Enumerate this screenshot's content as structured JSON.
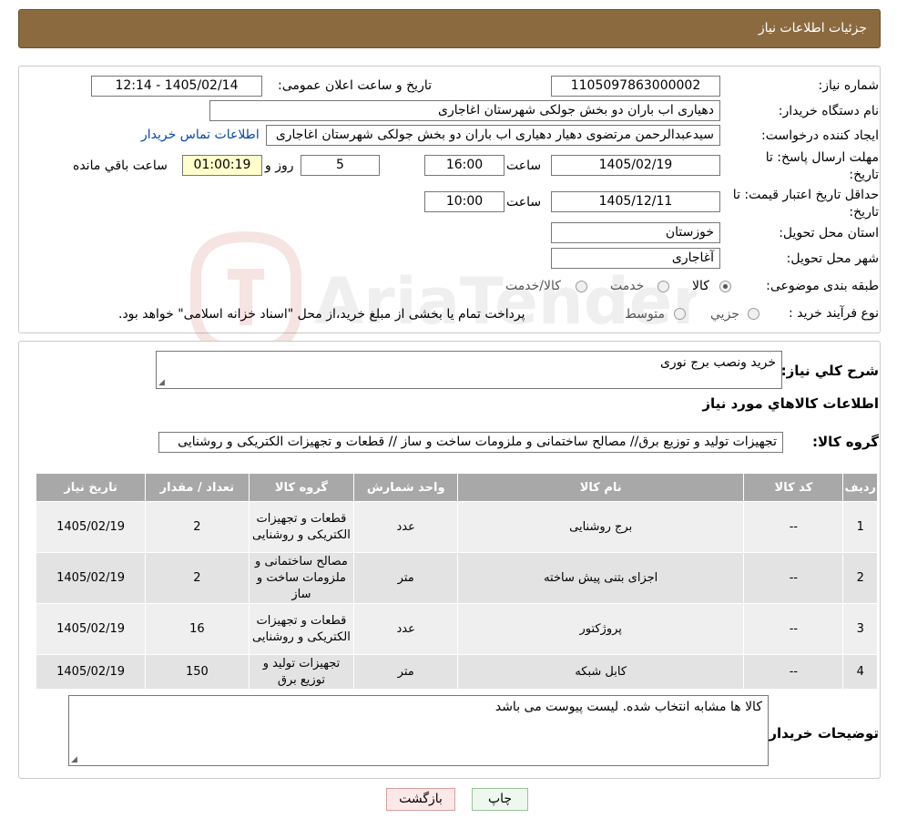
{
  "header": {
    "title": "جزئیات اطلاعات نیاز"
  },
  "form": {
    "need_number_label": "شماره نیاز:",
    "need_number": "1105097863000002",
    "announce_label": "تاریخ و ساعت اعلان عمومی:",
    "announce_value": "1405/02/14 - 12:14",
    "buyer_org_label": "نام دستگاه خریدار:",
    "buyer_org": "دهیاری اب باران دو بخش جولکی شهرستان اغاجاری",
    "requester_label": "ایجاد کننده درخواست:",
    "requester": "سیدعبدالرحمن مرتضوی دهیار دهیاری اب باران دو بخش جولکی شهرستان اغاجاری",
    "contact_link": "اطلاعات تماس خریدار",
    "deadline_label_1": "مهلت ارسال پاسخ: تا",
    "deadline_label_2": "تاریخ:",
    "deadline_date": "1405/02/19",
    "time_label": "ساعت",
    "deadline_time": "16:00",
    "days_value": "5",
    "days_label": "روز و",
    "remaining_time": "01:00:19",
    "remaining_label": "ساعت باقي مانده",
    "validity_label_1": "حداقل تاریخ اعتبار قیمت: تا",
    "validity_label_2": "تاریخ:",
    "validity_date": "1405/12/11",
    "validity_time_label": "ساعت",
    "validity_time": "10:00",
    "province_label": "استان محل تحویل:",
    "province": "خوزستان",
    "city_label": "شهر محل تحویل:",
    "city": "آغاجاری",
    "category_label": "طبقه بندی موضوعی:",
    "category_options": [
      "کالا",
      "خدمت",
      "کالا/خدمت"
    ],
    "category_selected": "کالا",
    "process_label": "نوع فرآیند خرید :",
    "process_options": [
      "جزیي",
      "متوسط"
    ],
    "process_note": "پرداخت تمام یا بخشی از مبلغ خرید،از محل \"اسناد خزانه اسلامی\" خواهد بود."
  },
  "details": {
    "summary_label": "شرح کلي نياز:",
    "summary": "خرید ونصب برج نوری",
    "goods_info_title": "اطلاعات کالاهاي مورد نياز",
    "goods_group_label": "گروه کالا:",
    "goods_group": "تجهیزات تولید و توزیع برق// مصالح ساختمانی و ملزومات ساخت و ساز // قطعات و تجهیزات الکتریکی و روشنایی",
    "table": {
      "headers": [
        "رديف",
        "کد کالا",
        "نام کالا",
        "واحد شمارش",
        "گروه کالا",
        "تعداد / مقدار",
        "تاریخ نیاز"
      ],
      "rows": [
        [
          "1",
          "--",
          "برج روشنایی",
          "عدد",
          "قطعات و تجهیزات الکتریکی و روشنایی",
          "2",
          "1405/02/19"
        ],
        [
          "2",
          "--",
          "اجزای بتنی پیش ساخته",
          "متر",
          "مصالح ساختمانی و ملزومات ساخت و ساز",
          "2",
          "1405/02/19"
        ],
        [
          "3",
          "--",
          "پروژکتور",
          "عدد",
          "قطعات و تجهیزات الکتریکی و روشنایی",
          "16",
          "1405/02/19"
        ],
        [
          "4",
          "--",
          "کابل شبکه",
          "متر",
          "تجهیزات تولید و توزیع برق",
          "150",
          "1405/02/19"
        ]
      ]
    },
    "buyer_notes_label": "توضیحات خریدار:",
    "buyer_notes": "کالا ها مشابه انتخاب شده. لیست پیوست می باشد"
  },
  "buttons": {
    "print": "چاپ",
    "back": "بازگشت"
  },
  "watermark": {
    "text": "AriaTender.neT"
  },
  "colors": {
    "header": "#8c6a3f",
    "back_button": "#fde8e8",
    "print_button": "#eef8ee"
  }
}
